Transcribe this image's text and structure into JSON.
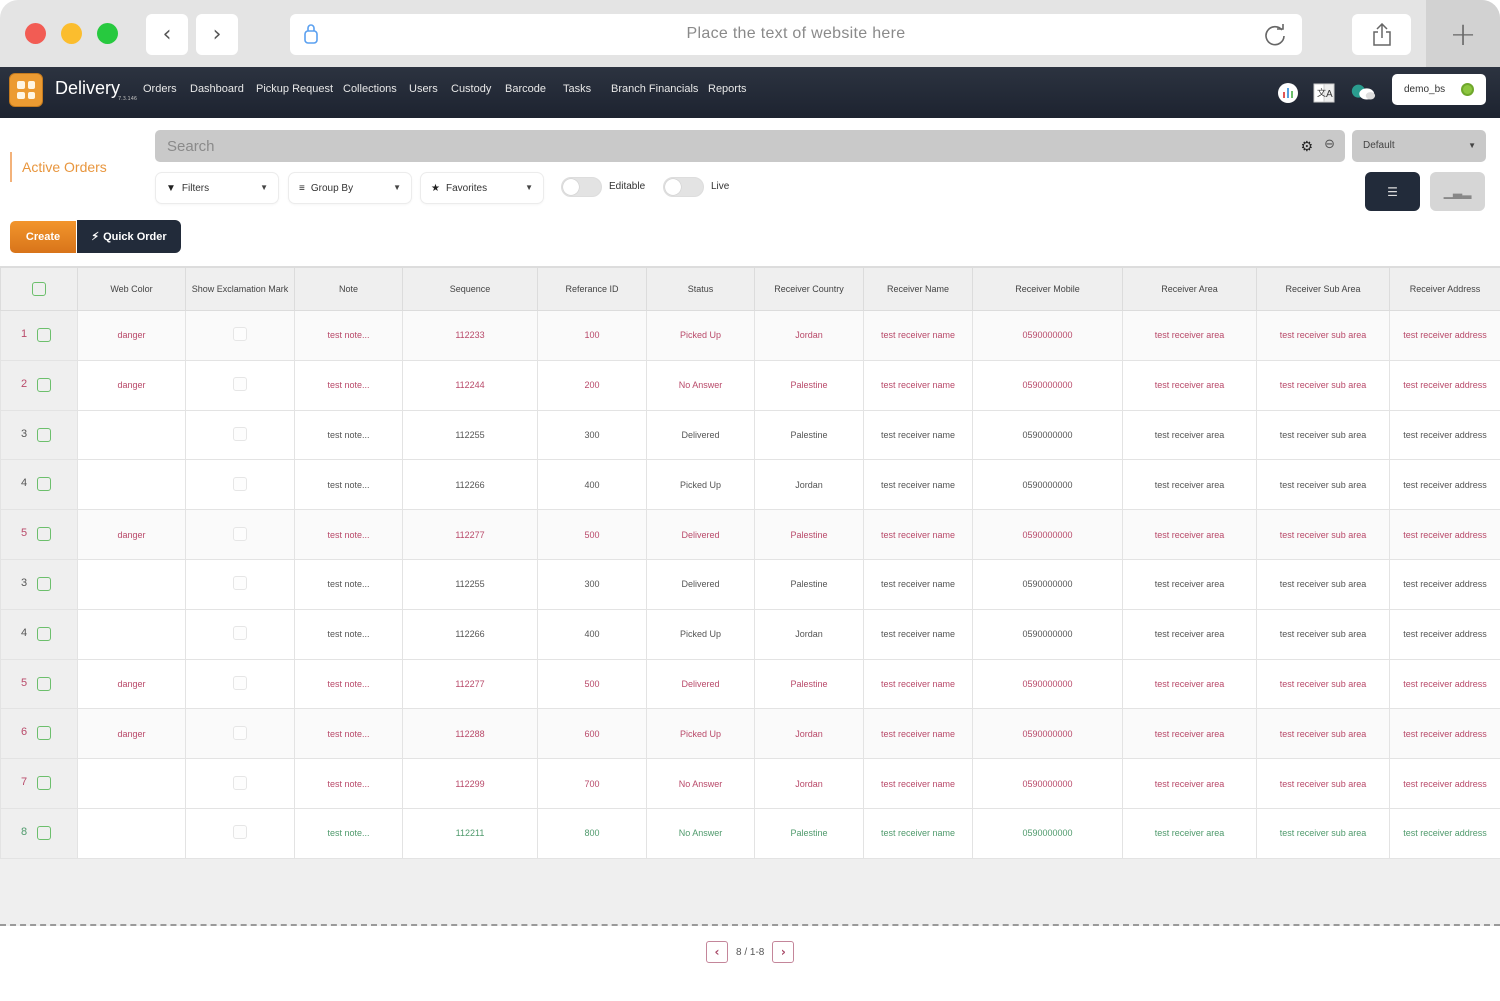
{
  "browser": {
    "url_placeholder": "Place the text of website here",
    "back_icon": "chevron-left-icon",
    "forward_icon": "chevron-right-icon",
    "new_tab_icon": "plus-icon"
  },
  "app": {
    "brand": "Delivery",
    "version": "7.3.146",
    "menu": [
      "Orders",
      "Dashboard",
      "Pickup Request",
      "Collections",
      "Users",
      "Custody",
      "Barcode",
      "Tasks",
      "Branch Financials",
      "Reports"
    ],
    "user": "demo_bs"
  },
  "page": {
    "title": "Active Orders",
    "search_placeholder": "Search",
    "view_select": "Default",
    "filters_label": "Filters",
    "group_by_label": "Group By",
    "favorites_label": "Favorites",
    "editable_label": "Editable",
    "editable_on": false,
    "live_label": "Live",
    "live_on": false,
    "create_label": "Create",
    "quick_order_label": "Quick Order"
  },
  "colors": {
    "danger_text": "#b94a6a",
    "success_text": "#4f9a6c",
    "accent_orange": "#e8963e",
    "navbar": "#1d2330"
  },
  "table": {
    "columns": [
      "Web Color",
      "Show Exclamation Mark",
      "Note",
      "Sequence",
      "Referance ID",
      "Status",
      "Receiver Country",
      "Receiver Name",
      "Receiver Mobile",
      "Receiver Area",
      "Receiver Sub Area",
      "Receiver Address"
    ],
    "rows": [
      {
        "n": "1",
        "tone": "danger",
        "cells": [
          "danger",
          "",
          "test note...",
          "112233",
          "100",
          "Picked Up",
          "Jordan",
          "test receiver name",
          "0590000000",
          "test receiver area",
          "test receiver sub area",
          "test receiver address"
        ]
      },
      {
        "n": "2",
        "tone": "danger",
        "cells": [
          "danger",
          "",
          "test note...",
          "112244",
          "200",
          "No Answer",
          "Palestine",
          "test receiver name",
          "0590000000",
          "test receiver area",
          "test receiver sub area",
          "test receiver address"
        ]
      },
      {
        "n": "3",
        "tone": "normal",
        "cells": [
          "",
          "",
          "test note...",
          "112255",
          "300",
          "Delivered",
          "Palestine",
          "test receiver name",
          "0590000000",
          "test receiver area",
          "test receiver sub area",
          "test receiver address"
        ]
      },
      {
        "n": "4",
        "tone": "normal",
        "cells": [
          "",
          "",
          "test note...",
          "112266",
          "400",
          "Picked Up",
          "Jordan",
          "test receiver name",
          "0590000000",
          "test receiver area",
          "test receiver sub area",
          "test receiver address"
        ]
      },
      {
        "n": "5",
        "tone": "danger",
        "cells": [
          "danger",
          "",
          "test note...",
          "112277",
          "500",
          "Delivered",
          "Palestine",
          "test receiver name",
          "0590000000",
          "test receiver area",
          "test receiver sub area",
          "test receiver address"
        ]
      },
      {
        "n": "3",
        "tone": "normal",
        "cells": [
          "",
          "",
          "test note...",
          "112255",
          "300",
          "Delivered",
          "Palestine",
          "test receiver name",
          "0590000000",
          "test receiver area",
          "test receiver sub area",
          "test receiver address"
        ]
      },
      {
        "n": "4",
        "tone": "normal",
        "cells": [
          "",
          "",
          "test note...",
          "112266",
          "400",
          "Picked Up",
          "Jordan",
          "test receiver name",
          "0590000000",
          "test receiver area",
          "test receiver sub area",
          "test receiver address"
        ]
      },
      {
        "n": "5",
        "tone": "danger",
        "cells": [
          "danger",
          "",
          "test note...",
          "112277",
          "500",
          "Delivered",
          "Palestine",
          "test receiver name",
          "0590000000",
          "test receiver area",
          "test receiver sub area",
          "test receiver address"
        ]
      },
      {
        "n": "6",
        "tone": "danger",
        "cells": [
          "danger",
          "",
          "test note...",
          "112288",
          "600",
          "Picked Up",
          "Jordan",
          "test receiver name",
          "0590000000",
          "test receiver area",
          "test receiver sub area",
          "test receiver address"
        ]
      },
      {
        "n": "7",
        "tone": "danger",
        "cells": [
          "",
          "",
          "test note...",
          "112299",
          "700",
          "No Answer",
          "Jordan",
          "test receiver name",
          "0590000000",
          "test receiver area",
          "test receiver sub area",
          "test receiver address"
        ]
      },
      {
        "n": "8",
        "tone": "success",
        "cells": [
          "",
          "",
          "test note...",
          "112211",
          "800",
          "No Answer",
          "Palestine",
          "test receiver name",
          "0590000000",
          "test receiver area",
          "test receiver sub area",
          "test receiver address"
        ]
      }
    ]
  },
  "pager": {
    "label": "8 / 1-8"
  }
}
